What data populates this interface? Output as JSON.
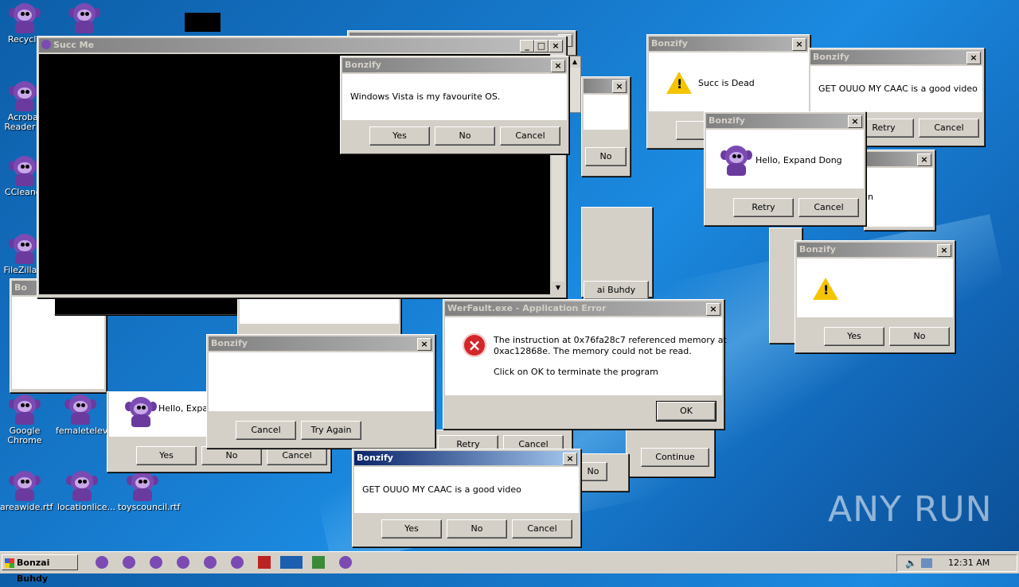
{
  "desktop": {
    "icons": [
      {
        "label": "Recycle"
      },
      {
        "label": "Acrobat Reader D"
      },
      {
        "label": "CCleaner"
      },
      {
        "label": "FileZilla C"
      },
      {
        "label": "Google Chrome"
      },
      {
        "label": "femaletelevi..."
      },
      {
        "label": "areawide.rtf"
      },
      {
        "label": "locationlice..."
      },
      {
        "label": "toyscouncil.rtf"
      }
    ]
  },
  "windows": {
    "succ": {
      "title": "Succ Me"
    },
    "bonzify_vista": {
      "title": "Bonzify",
      "message": "Windows Vista is my favourite OS.",
      "yes": "Yes",
      "no": "No",
      "cancel": "Cancel"
    },
    "bonzify_succ_dead": {
      "title": "Bonzify",
      "message": "Succ is Dead"
    },
    "bonzify_ouuo_top": {
      "title": "Bonzify",
      "message": "GET OUUO MY CAAC is a good video",
      "retry": "Retry",
      "cancel": "Cancel"
    },
    "bonzify_expand": {
      "title": "Bonzify",
      "message": "Hello, Expand Dong",
      "retry": "Retry",
      "cancel": "Cancel"
    },
    "bonzify_warn_right": {
      "title": "Bonzify",
      "yes": "Yes",
      "no": "No"
    },
    "werfault": {
      "title": "WerFault.exe - Application Error",
      "line1": "The instruction at 0x76fa28c7 referenced memory at",
      "line2": "0xac12868e. The memory could not be read.",
      "line3": "Click on OK to terminate the program",
      "ok": "OK"
    },
    "bonzify_try": {
      "title": "Bonzify",
      "cancel": "Cancel",
      "try_again": "Try Again"
    },
    "bonzify_hello_left": {
      "message": "Hello, Expan",
      "yes": "Yes",
      "no": "No",
      "cancel": "Cancel"
    },
    "bonzify_ouuo_bottom": {
      "title": "Bonzify",
      "message": "GET OUUO MY CAAC is a good video",
      "yes": "Yes",
      "no": "No",
      "cancel": "Cancel"
    },
    "behind": {
      "no1": "No",
      "bonzi_buhdy": "ai Buhdy",
      "retry": "Retry",
      "cancel": "Cancel",
      "continue": "Continue",
      "no2": "No",
      "n": "n",
      "bo": "Bo"
    }
  },
  "taskbar": {
    "start_label": "Bonzai Buhdy",
    "clock": "12:31 AM"
  },
  "watermark": {
    "text": "ANY RUN"
  },
  "colors": {
    "titlebar_active": "#0a246a",
    "titlebar_inactive": "#808080",
    "error_icon": "#d3262a",
    "warning_icon": "#f5c400"
  }
}
